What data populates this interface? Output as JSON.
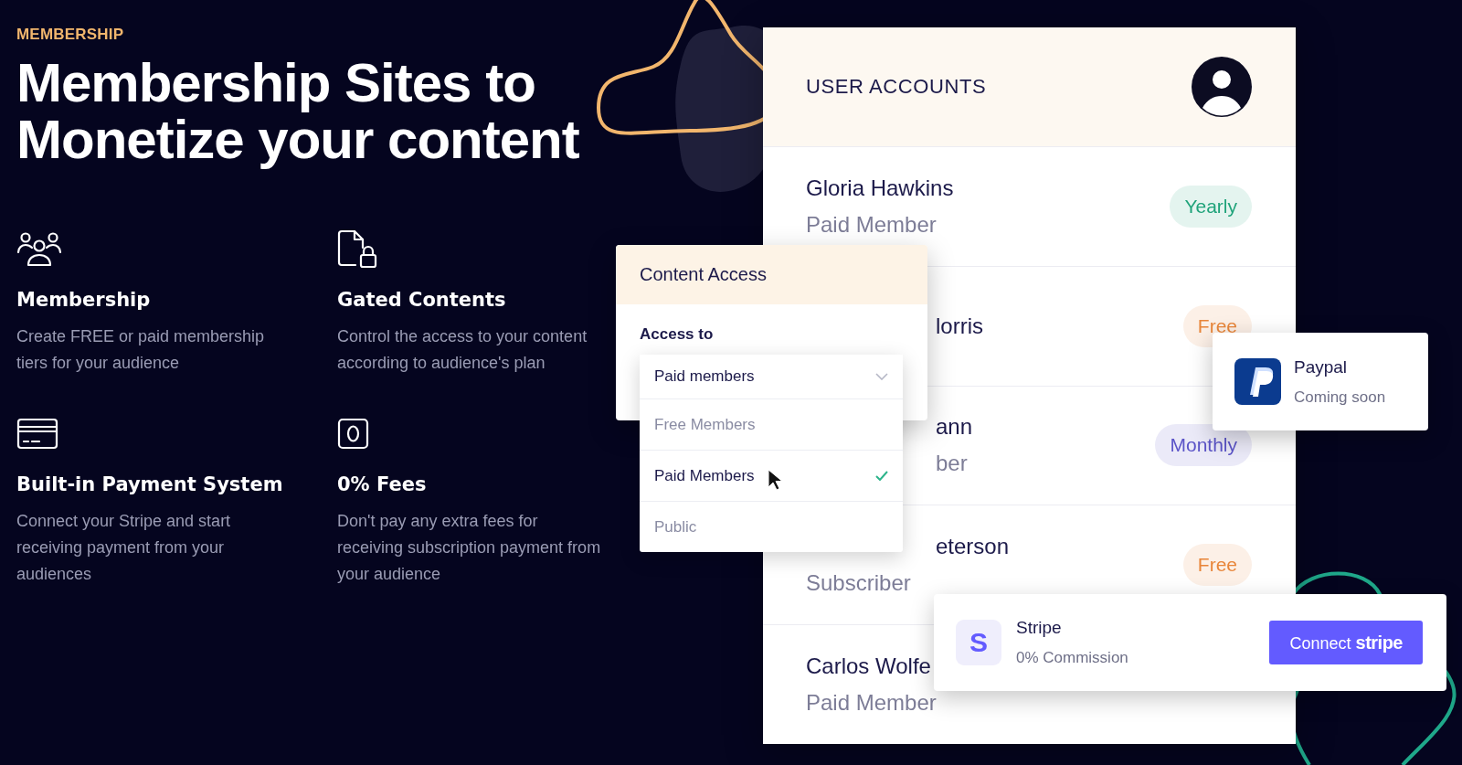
{
  "eyebrow": "MEMBERSHIP",
  "headline": [
    "Membership Sites to",
    "Monetize your content"
  ],
  "features": [
    {
      "kind": "people",
      "title": "Membership",
      "text": "Create FREE or paid membership tiers for your audience"
    },
    {
      "kind": "locked-file",
      "title": "Gated Contents",
      "text": "Control the access to your content according to audience's plan"
    },
    {
      "kind": "card",
      "title": "Built-in Payment System",
      "text": "Connect your Stripe and start receiving payment from your audiences"
    },
    {
      "kind": "zero",
      "title": "0% Fees",
      "text": "Don't pay any extra fees for receiving subscription payment from your audience"
    }
  ],
  "accounts": {
    "title": "USER ACCOUNTS",
    "rows": [
      {
        "name": {
          "text": "Gloria Hawkins"
        },
        "role": {
          "text": "Paid Member"
        },
        "badge": {
          "text": "Yearly",
          "color": "#1fa37a"
        }
      },
      {
        "name": {
          "text": "lorris",
          "covered": true
        },
        "badge": {
          "text": "Free",
          "color": "#e8863a"
        }
      },
      {
        "name": {
          "text": "ann",
          "covered": true
        },
        "role": {
          "text": "ber",
          "covered": true
        },
        "badge": {
          "text": "Monthly",
          "color": "#5b54c8"
        }
      },
      {
        "name": {
          "text": "eterson",
          "covered": true
        },
        "role": {
          "text": "Subscriber"
        },
        "badge": {
          "text": "Free",
          "color": "#e8863a"
        }
      },
      {
        "name": {
          "text": "Carlos Wolfe"
        },
        "role": {
          "text": "Paid Member"
        }
      }
    ]
  },
  "content_access": {
    "title": "Content Access",
    "label": "Access to",
    "value": "Paid members",
    "options": [
      {
        "label": "Free Members",
        "selected": false
      },
      {
        "label": "Paid Members",
        "selected": true
      },
      {
        "label": "Public",
        "selected": false
      }
    ]
  },
  "paypal": {
    "name": "Paypal",
    "status": "Coming soon"
  },
  "stripe": {
    "logo_letter": "S",
    "name": "Stripe",
    "detail": "0% Commission",
    "button": "Connect **stripe**"
  }
}
